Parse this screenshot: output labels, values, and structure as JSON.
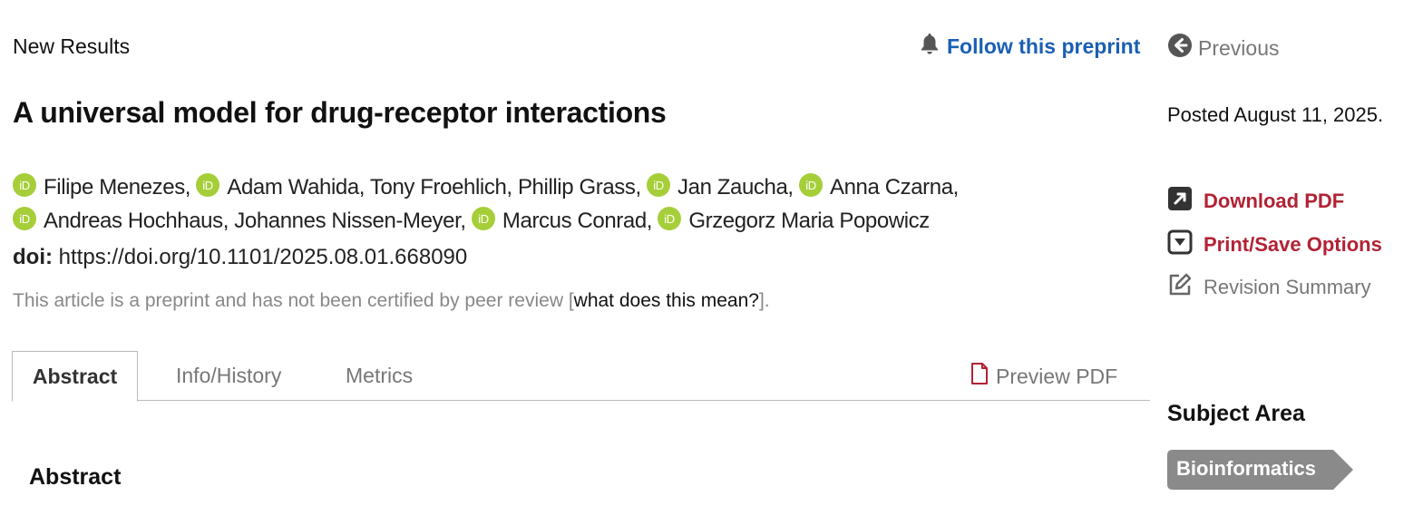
{
  "header": {
    "section_label": "New Results",
    "follow_label": "Follow this preprint",
    "previous_label": "Previous"
  },
  "article": {
    "title": "A universal model for drug-receptor interactions",
    "authors": [
      {
        "name": "Filipe Menezes,",
        "orcid": true
      },
      {
        "name": "Adam Wahida,",
        "orcid": true
      },
      {
        "name": "Tony Froehlich,",
        "orcid": false
      },
      {
        "name": "Phillip Grass,",
        "orcid": false
      },
      {
        "name": "Jan Zaucha,",
        "orcid": true
      },
      {
        "name": "Anna Czarna,",
        "orcid": true
      },
      {
        "name": "Andreas Hochhaus,",
        "orcid": true
      },
      {
        "name": "Johannes Nissen-Meyer,",
        "orcid": false
      },
      {
        "name": "Marcus Conrad,",
        "orcid": true
      },
      {
        "name": "Grzegorz Maria Popowicz",
        "orcid": true
      }
    ],
    "doi_label": "doi:",
    "doi_value": "https://doi.org/10.1101/2025.08.01.668090",
    "peer_review_note": "This article is a preprint and has not been certified by peer review [",
    "peer_review_link": "what does this mean?",
    "peer_review_end": "]."
  },
  "tabs": {
    "abstract": "Abstract",
    "info_history": "Info/History",
    "metrics": "Metrics",
    "preview_pdf": "Preview PDF"
  },
  "content": {
    "abstract_heading": "Abstract"
  },
  "sidebar": {
    "posted": "Posted August 11, 2025.",
    "download_pdf": "Download PDF",
    "print_save": "Print/Save Options",
    "revision_summary": "Revision Summary",
    "subject_heading": "Subject Area",
    "subject_tag": "Bioinformatics"
  },
  "colors": {
    "link_blue": "#1a5fb4",
    "action_red": "#b22234",
    "orcid_green": "#a6ce39",
    "tag_gray": "#8a8a8a"
  }
}
